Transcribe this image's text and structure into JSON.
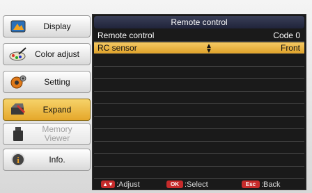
{
  "nav": {
    "items": [
      {
        "label": "Display",
        "icon": "display-icon"
      },
      {
        "label": "Color adjust",
        "icon": "color-adjust-icon"
      },
      {
        "label": "Setting",
        "icon": "setting-icon"
      },
      {
        "label": "Expand",
        "icon": "expand-icon",
        "state": "selected"
      },
      {
        "label": "Memory Viewer",
        "icon": "memory-viewer-icon",
        "state": "disabled"
      },
      {
        "label": "Info.",
        "icon": "info-icon"
      }
    ]
  },
  "panel": {
    "title": "Remote control",
    "rows": [
      {
        "label": "Remote control",
        "value": "Code 0"
      },
      {
        "label": "RC sensor",
        "value": "Front",
        "selected": true
      }
    ]
  },
  "footer": {
    "adjust_key": "▲▼",
    "adjust_label": ":Adjust",
    "select_key": "OK",
    "select_label": ":Select",
    "back_key": "Esc",
    "back_label": ":Back"
  },
  "colors": {
    "highlight": "#e5a72a",
    "panel_bg": "#1a1a1a",
    "key_red": "#c62b2b"
  }
}
